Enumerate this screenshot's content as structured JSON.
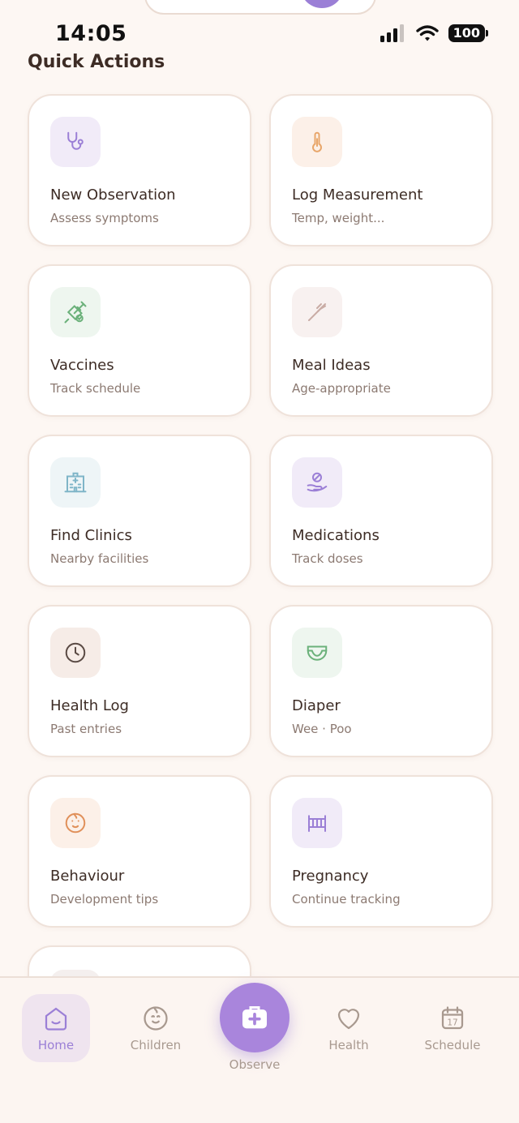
{
  "status": {
    "time": "14:05",
    "battery": "100"
  },
  "section_title": "Quick Actions",
  "cards": [
    {
      "title": "New Observation",
      "subtitle": "Assess symptoms",
      "icon": "stethoscope-icon",
      "bg": "#f1ebf8",
      "color": "#9b7fd6"
    },
    {
      "title": "Log Measurement",
      "subtitle": "Temp, weight...",
      "icon": "thermometer-icon",
      "bg": "#fcf0e8",
      "color": "#e8a66a"
    },
    {
      "title": "Vaccines",
      "subtitle": "Track schedule",
      "icon": "syringe-icon",
      "bg": "#eef6ef",
      "color": "#6bb17a"
    },
    {
      "title": "Meal Ideas",
      "subtitle": "Age-appropriate",
      "icon": "fork-icon",
      "bg": "#f8f1f0",
      "color": "#c9aca5"
    },
    {
      "title": "Find Clinics",
      "subtitle": "Nearby facilities",
      "icon": "hospital-icon",
      "bg": "#eef5f7",
      "color": "#7fb5c8"
    },
    {
      "title": "Medications",
      "subtitle": "Track doses",
      "icon": "pill-hand-icon",
      "bg": "#f1ebf8",
      "color": "#9b7fd6"
    },
    {
      "title": "Health Log",
      "subtitle": "Past entries",
      "icon": "clock-icon",
      "bg": "#f6ece7",
      "color": "#5a4a44"
    },
    {
      "title": "Diaper",
      "subtitle": "Wee · Poo",
      "icon": "diaper-icon",
      "bg": "#eef6ef",
      "color": "#6bb17a"
    },
    {
      "title": "Behaviour",
      "subtitle": "Development tips",
      "icon": "baby-face-icon",
      "bg": "#fcf0e8",
      "color": "#e0905a"
    },
    {
      "title": "Pregnancy",
      "subtitle": "Continue tracking",
      "icon": "crib-icon",
      "bg": "#f1ebf8",
      "color": "#9b7fd6"
    }
  ],
  "nav": {
    "home": "Home",
    "children": "Children",
    "observe": "Observe",
    "health": "Health",
    "schedule": "Schedule",
    "schedule_day": "17"
  },
  "colors": {
    "accent": "#9b7fd6",
    "background": "#fdf7f3"
  }
}
